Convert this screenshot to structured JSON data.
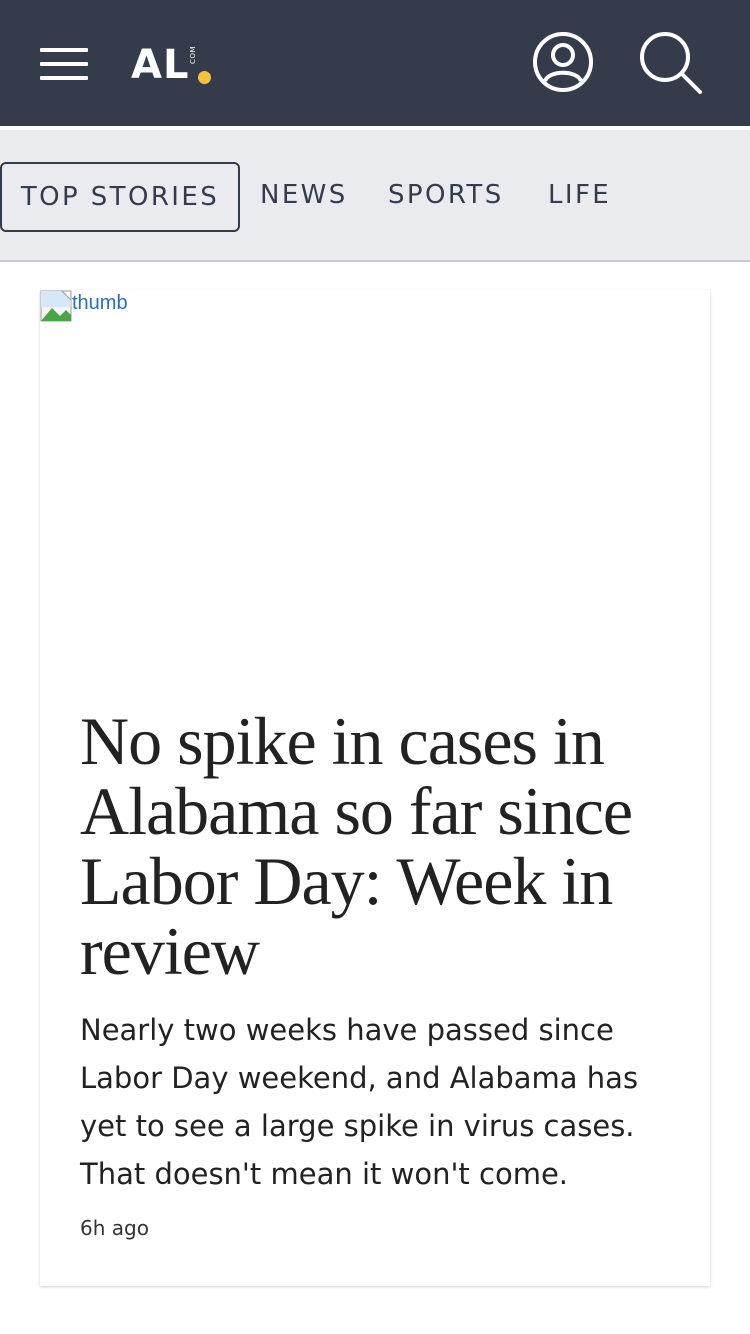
{
  "header": {
    "menu_icon": "hamburger-menu-icon",
    "logo": {
      "text": "AL",
      "suffix": "COM",
      "dot_color": "#f6c142"
    },
    "account_icon": "user-account-icon",
    "search_icon": "search-icon",
    "background_color": "#343c4b"
  },
  "tabs": [
    {
      "label": "TOP STORIES",
      "active": true
    },
    {
      "label": "NEWS",
      "active": false
    },
    {
      "label": "SPORTS",
      "active": false
    },
    {
      "label": "LIFE",
      "active": false
    }
  ],
  "article": {
    "thumb_alt": "thumb",
    "headline": "No spike in cases in Alabama so far since Labor Day: Week in review",
    "summary": "Nearly two weeks have passed since Labor Day weekend, and Alabama has yet to see a large spike in virus cases. That doesn't mean it won't come.",
    "time": "6h ago"
  }
}
